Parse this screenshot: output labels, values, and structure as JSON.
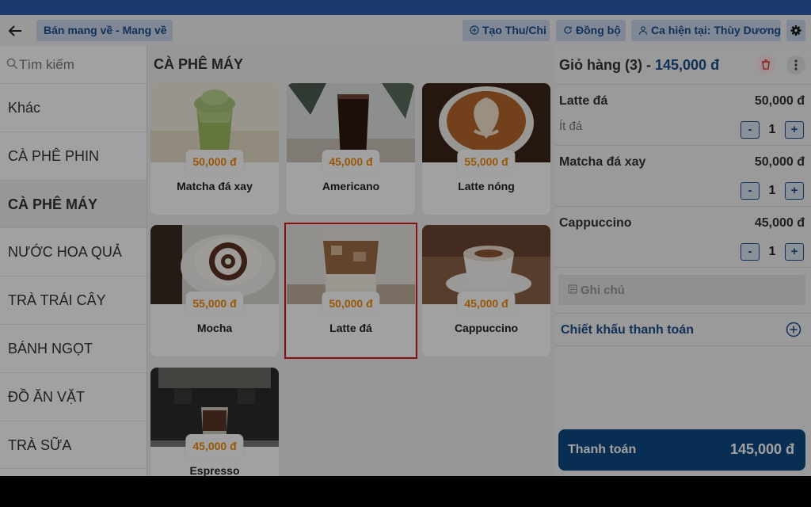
{
  "topbar": {
    "mode_label": "Bán mang về - Mang về",
    "thuchi_label": "Tạo Thu/Chi",
    "sync_label": "Đồng bộ",
    "shift_label": "Ca hiện tại: Thùy Dương"
  },
  "search": {
    "placeholder": "Tìm kiếm"
  },
  "categories": {
    "items": [
      {
        "label": "Khác"
      },
      {
        "label": "CÀ PHÊ PHIN"
      },
      {
        "label": "CÀ PHÊ MÁY",
        "active": true
      },
      {
        "label": "NƯỚC HOA QUẢ"
      },
      {
        "label": "TRÀ TRÁI CÂY"
      },
      {
        "label": "BÁNH NGỌT"
      },
      {
        "label": "ĐỒ ĂN VẶT"
      },
      {
        "label": "TRÀ SỮA"
      }
    ]
  },
  "products": {
    "section_title": "CÀ PHÊ MÁY",
    "items": [
      {
        "name": "Matcha đá xay",
        "price": "50,000 đ"
      },
      {
        "name": "Americano",
        "price": "45,000 đ"
      },
      {
        "name": "Latte nóng",
        "price": "55,000 đ"
      },
      {
        "name": "Mocha",
        "price": "55,000 đ"
      },
      {
        "name": "Latte đá",
        "price": "50,000 đ",
        "selected": true
      },
      {
        "name": "Cappuccino",
        "price": "45,000 đ"
      },
      {
        "name": "Espresso",
        "price": "45,000 đ"
      }
    ]
  },
  "cart": {
    "title": "Giỏ hàng (3) - ",
    "total": "145,000 đ",
    "items": [
      {
        "name": "Latte đá",
        "price": "50,000 đ",
        "note": "Ít đá",
        "qty": "1"
      },
      {
        "name": "Matcha đá xay",
        "price": "50,000 đ",
        "note": "",
        "qty": "1"
      },
      {
        "name": "Cappuccino",
        "price": "45,000 đ",
        "note": "",
        "qty": "1"
      }
    ],
    "qty_minus": "-",
    "qty_plus": "+",
    "note_placeholder": "Ghi chú",
    "discount_label": "Chiết khấu thanh toán",
    "pay_label": "Thanh toán",
    "pay_total": "145,000 đ"
  },
  "colors": {
    "brand": "#1c4e8c",
    "price": "#f08a0c",
    "selected_outline": "#d9161c",
    "statusbar": "#1b3a6e"
  },
  "icons": [
    "back-arrow-icon",
    "plus-circle-icon",
    "sync-icon",
    "user-icon",
    "gear-icon",
    "search-icon",
    "trash-icon",
    "more-vertical-icon",
    "note-icon",
    "add-circle-icon"
  ]
}
